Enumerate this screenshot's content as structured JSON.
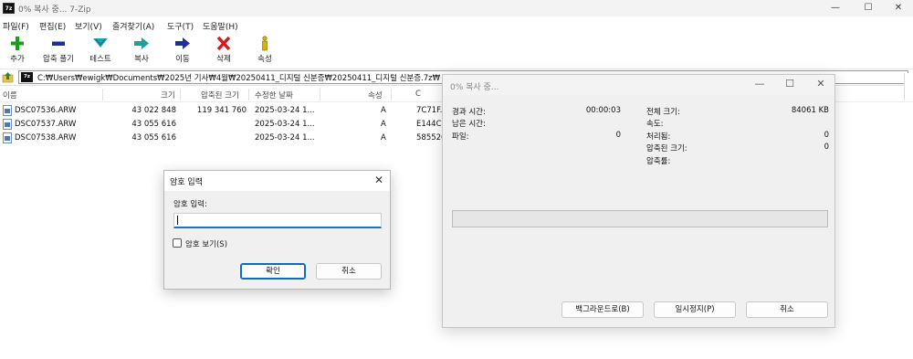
{
  "window": {
    "title": "0% 복사 중... 7-Zip",
    "app_icon": "7z",
    "controls": {
      "minimize": "—",
      "maximize": "☐",
      "close": "✕"
    }
  },
  "menu": [
    "파일(F)",
    "편집(E)",
    "보기(V)",
    "즐겨찾기(A)",
    "도구(T)",
    "도움말(H)"
  ],
  "toolbar": [
    {
      "label": "추가",
      "icon": "add-plus-icon",
      "color": "#1a9e1a"
    },
    {
      "label": "압축 풀기",
      "icon": "extract-minus-icon",
      "color": "#1d2f9a"
    },
    {
      "label": "테스트",
      "icon": "test-check-icon",
      "color": "#19a3b3"
    },
    {
      "label": "복사",
      "icon": "copy-arrow-icon",
      "color": "#19a39a"
    },
    {
      "label": "이동",
      "icon": "move-arrow-icon",
      "color": "#1d2f9a"
    },
    {
      "label": "삭제",
      "icon": "delete-x-icon",
      "color": "#d41a1a"
    },
    {
      "label": "속성",
      "icon": "info-icon",
      "color": "#d8b300"
    }
  ],
  "path": "C:₩Users₩ewigk₩Documents₩2025년 기사₩4월₩20250411_디지털 신분증₩20250411_디지털 신분증.7z₩",
  "columns": [
    "이름",
    "크기",
    "압축된 크기",
    "수정한 날짜",
    "속성",
    "C"
  ],
  "files": [
    {
      "name": "DSC07536.ARW",
      "size": "43 022 848",
      "packed": "119 341 760",
      "modified": "2025-03-24 1...",
      "attr": "A",
      "crc": "7C71F..."
    },
    {
      "name": "DSC07537.ARW",
      "size": "43 055 616",
      "packed": "",
      "modified": "2025-03-24 1...",
      "attr": "A",
      "crc": "E144C..."
    },
    {
      "name": "DSC07538.ARW",
      "size": "43 055 616",
      "packed": "",
      "modified": "2025-03-24 1...",
      "attr": "A",
      "crc": "585526..."
    }
  ],
  "password_dialog": {
    "title": "암호 입력",
    "label": "암호 입력:",
    "value": "",
    "show_password_label": "암호 보기(S)",
    "show_password_checked": false,
    "ok_label": "확인",
    "cancel_label": "취소",
    "close": "✕"
  },
  "progress_dialog": {
    "title": "0% 복사 중...",
    "elapsed_label": "경과 시간:",
    "elapsed_value": "00:00:03",
    "remaining_label": "남은 시간:",
    "remaining_value": "",
    "files_label": "파일:",
    "files_value": "0",
    "total_size_label": "전체 크기:",
    "total_size_value": "84061 KB",
    "speed_label": "속도:",
    "speed_value": "",
    "processed_label": "처리됨:",
    "processed_value": "0",
    "compressed_label": "압축된 크기:",
    "compressed_value": "0",
    "ratio_label": "압축률:",
    "ratio_value": "",
    "progress_percent": 0,
    "background_label": "백그라운드로(B)",
    "pause_label": "일시정지(P)",
    "cancel_label": "취소",
    "controls": {
      "minimize": "—",
      "maximize": "☐",
      "close": "✕"
    }
  }
}
